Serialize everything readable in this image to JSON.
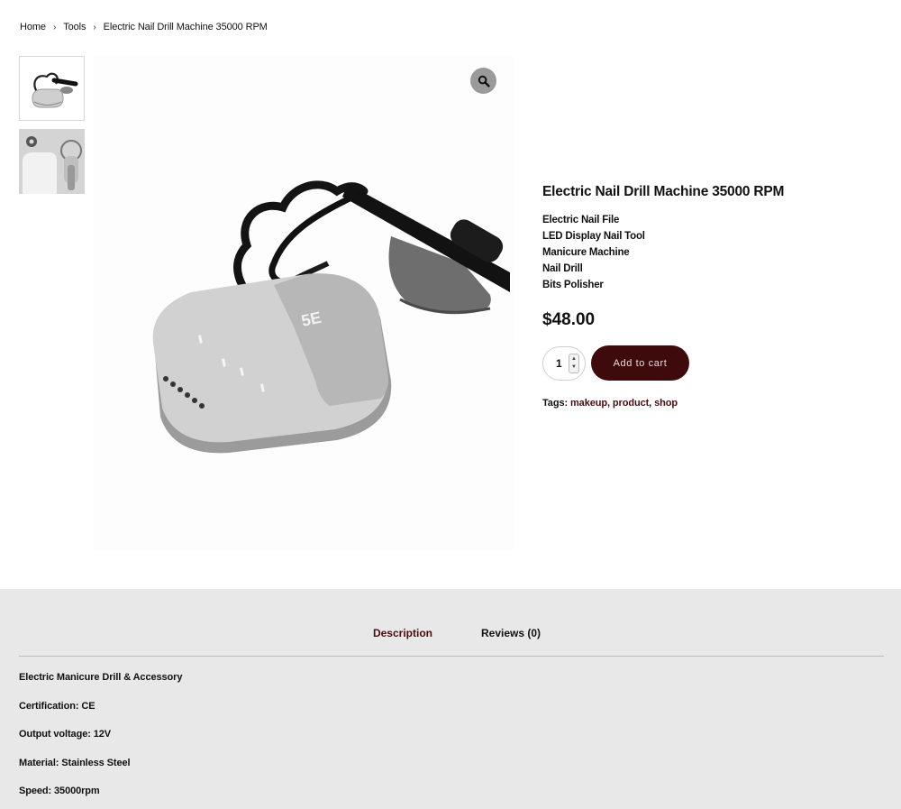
{
  "breadcrumb": {
    "items": [
      "Home",
      "Tools",
      "Electric Nail Drill Machine 35000 RPM"
    ],
    "separator": "›"
  },
  "gallery": {
    "thumbnails": [
      "drill-thumbnail-1",
      "drill-thumbnail-2"
    ],
    "zoom_icon": "magnifier-icon"
  },
  "product": {
    "title": "Electric Nail Drill Machine 35000 RPM",
    "features": [
      "Electric Nail File",
      "LED Display Nail Tool",
      "Manicure Machine",
      "Nail Drill",
      "Bits Polisher"
    ],
    "price": "$48.00",
    "quantity": "1",
    "add_to_cart_label": "Add to cart",
    "tags_label": "Tags:",
    "tags": [
      "makeup",
      "product",
      "shop"
    ],
    "tags_separator": ", "
  },
  "tabs": [
    {
      "label": "Description",
      "active": true
    },
    {
      "label": "Reviews (0)",
      "active": false
    }
  ],
  "description": [
    "Electric Manicure Drill & Accessory",
    "Certification: CE",
    "Output voltage: 12V",
    "Material: Stainless Steel",
    "Speed: 35000rpm"
  ],
  "colors": {
    "accent": "#3e0a0b",
    "link": "#4a0d10",
    "tabs_background": "#e8e8e8"
  }
}
